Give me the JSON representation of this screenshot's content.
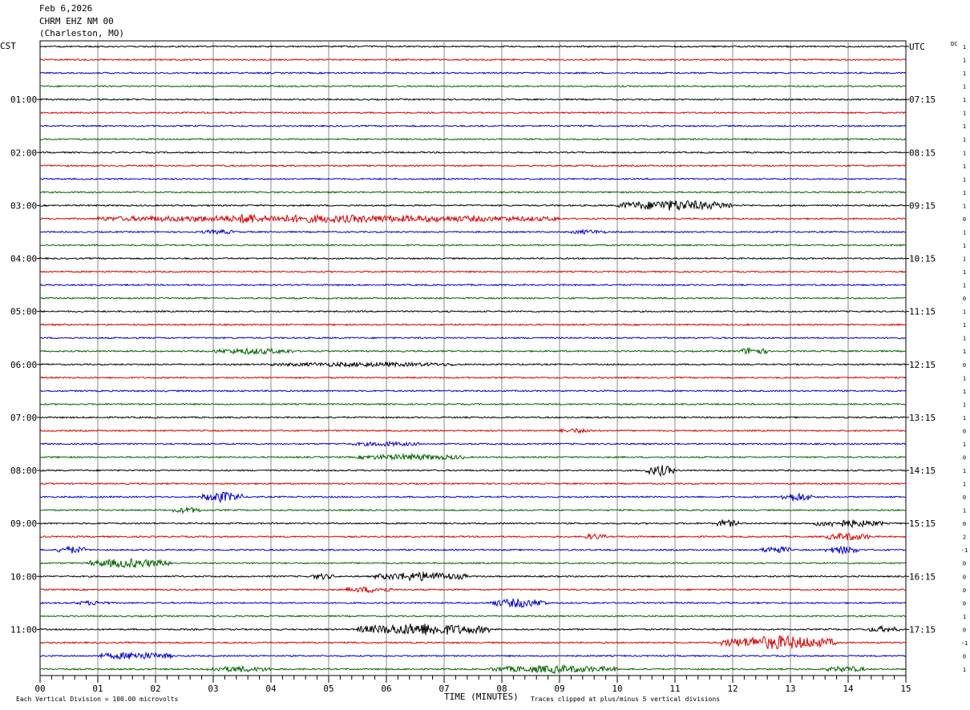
{
  "header": {
    "date": "Feb 6,2026",
    "station": "CHRM EHZ NM 00",
    "location": "(Charleston, MO)"
  },
  "labels": {
    "left_zone": "CST",
    "right_zone": "UTC",
    "dc_header": "DC",
    "footer_scale": "Each Vertical Division =  100.00 microvolts",
    "footer_clip": "Traces clipped at plus/minus 5 vertical divisions",
    "xlabel": "TIME (MINUTES)"
  },
  "chart_data": {
    "type": "line",
    "title": "",
    "xlabel": "TIME (MINUTES)",
    "xlim": [
      0,
      15
    ],
    "x_ticks": [
      "00",
      "01",
      "02",
      "03",
      "04",
      "05",
      "06",
      "07",
      "08",
      "09",
      "10",
      "11",
      "12",
      "13",
      "14",
      "15"
    ],
    "trace_count": 48,
    "trace_colors": [
      "#000000",
      "#dd0000",
      "#0000cc",
      "#006600"
    ],
    "left_hour_labels": [
      {
        "trace": 4,
        "label": "01:00"
      },
      {
        "trace": 8,
        "label": "02:00"
      },
      {
        "trace": 12,
        "label": "03:00"
      },
      {
        "trace": 16,
        "label": "04:00"
      },
      {
        "trace": 20,
        "label": "05:00"
      },
      {
        "trace": 24,
        "label": "06:00"
      },
      {
        "trace": 28,
        "label": "07:00"
      },
      {
        "trace": 32,
        "label": "08:00"
      },
      {
        "trace": 36,
        "label": "09:00"
      },
      {
        "trace": 40,
        "label": "10:00"
      },
      {
        "trace": 44,
        "label": "11:00"
      }
    ],
    "right_hour_labels": [
      {
        "trace": 0,
        "label": "UTC"
      },
      {
        "trace": 4,
        "label": "07:15"
      },
      {
        "trace": 8,
        "label": "08:15"
      },
      {
        "trace": 12,
        "label": "09:15"
      },
      {
        "trace": 16,
        "label": "10:15"
      },
      {
        "trace": 20,
        "label": "11:15"
      },
      {
        "trace": 24,
        "label": "12:15"
      },
      {
        "trace": 28,
        "label": "13:15"
      },
      {
        "trace": 32,
        "label": "14:15"
      },
      {
        "trace": 36,
        "label": "15:15"
      },
      {
        "trace": 40,
        "label": "16:15"
      },
      {
        "trace": 44,
        "label": "17:15"
      }
    ],
    "dc_offsets": [
      1,
      1,
      1,
      1,
      1,
      1,
      1,
      1,
      1,
      1,
      1,
      1,
      1,
      0,
      1,
      1,
      1,
      1,
      1,
      0,
      1,
      1,
      1,
      1,
      0,
      1,
      1,
      1,
      1,
      0,
      1,
      0,
      1,
      1,
      0,
      1,
      0,
      2,
      -1,
      0,
      0,
      0,
      0,
      1,
      0,
      -1,
      0,
      1
    ],
    "events": [
      {
        "trace": 12,
        "start": 10.0,
        "end": 12.0,
        "amp": 6
      },
      {
        "trace": 13,
        "start": 1.0,
        "end": 9.0,
        "amp": 4
      },
      {
        "trace": 13,
        "start": 3.4,
        "end": 3.8,
        "amp": 7
      },
      {
        "trace": 14,
        "start": 2.8,
        "end": 3.4,
        "amp": 2
      },
      {
        "trace": 14,
        "start": 9.2,
        "end": 9.8,
        "amp": 2
      },
      {
        "trace": 23,
        "start": 3.0,
        "end": 4.4,
        "amp": 3
      },
      {
        "trace": 23,
        "start": 12.1,
        "end": 12.6,
        "amp": 4
      },
      {
        "trace": 24,
        "start": 4.0,
        "end": 7.2,
        "amp": 2
      },
      {
        "trace": 29,
        "start": 9.0,
        "end": 9.6,
        "amp": 2
      },
      {
        "trace": 30,
        "start": 5.4,
        "end": 6.6,
        "amp": 2
      },
      {
        "trace": 31,
        "start": 5.5,
        "end": 7.4,
        "amp": 3
      },
      {
        "trace": 32,
        "start": 10.5,
        "end": 11.0,
        "amp": 6
      },
      {
        "trace": 34,
        "start": 2.8,
        "end": 3.5,
        "amp": 6
      },
      {
        "trace": 34,
        "start": 12.8,
        "end": 13.4,
        "amp": 5
      },
      {
        "trace": 35,
        "start": 2.3,
        "end": 2.8,
        "amp": 3
      },
      {
        "trace": 36,
        "start": 11.7,
        "end": 12.1,
        "amp": 4
      },
      {
        "trace": 36,
        "start": 13.4,
        "end": 14.6,
        "amp": 4
      },
      {
        "trace": 37,
        "start": 9.4,
        "end": 9.8,
        "amp": 3
      },
      {
        "trace": 37,
        "start": 13.6,
        "end": 14.4,
        "amp": 4
      },
      {
        "trace": 38,
        "start": 0.3,
        "end": 0.8,
        "amp": 4
      },
      {
        "trace": 38,
        "start": 12.5,
        "end": 13.0,
        "amp": 4
      },
      {
        "trace": 38,
        "start": 13.6,
        "end": 14.2,
        "amp": 4
      },
      {
        "trace": 39,
        "start": 0.8,
        "end": 2.3,
        "amp": 5
      },
      {
        "trace": 40,
        "start": 4.7,
        "end": 5.1,
        "amp": 3
      },
      {
        "trace": 40,
        "start": 5.8,
        "end": 7.4,
        "amp": 5
      },
      {
        "trace": 41,
        "start": 5.3,
        "end": 6.1,
        "amp": 3
      },
      {
        "trace": 42,
        "start": 7.8,
        "end": 8.8,
        "amp": 5
      },
      {
        "trace": 42,
        "start": 0.6,
        "end": 1.2,
        "amp": 2
      },
      {
        "trace": 44,
        "start": 5.5,
        "end": 7.8,
        "amp": 7
      },
      {
        "trace": 44,
        "start": 14.3,
        "end": 14.9,
        "amp": 3
      },
      {
        "trace": 45,
        "start": 11.8,
        "end": 13.8,
        "amp": 8
      },
      {
        "trace": 46,
        "start": 1.0,
        "end": 2.3,
        "amp": 4
      },
      {
        "trace": 47,
        "start": 2.9,
        "end": 4.0,
        "amp": 3
      },
      {
        "trace": 47,
        "start": 7.8,
        "end": 10.0,
        "amp": 4
      },
      {
        "trace": 47,
        "start": 13.6,
        "end": 14.3,
        "amp": 3
      }
    ]
  }
}
